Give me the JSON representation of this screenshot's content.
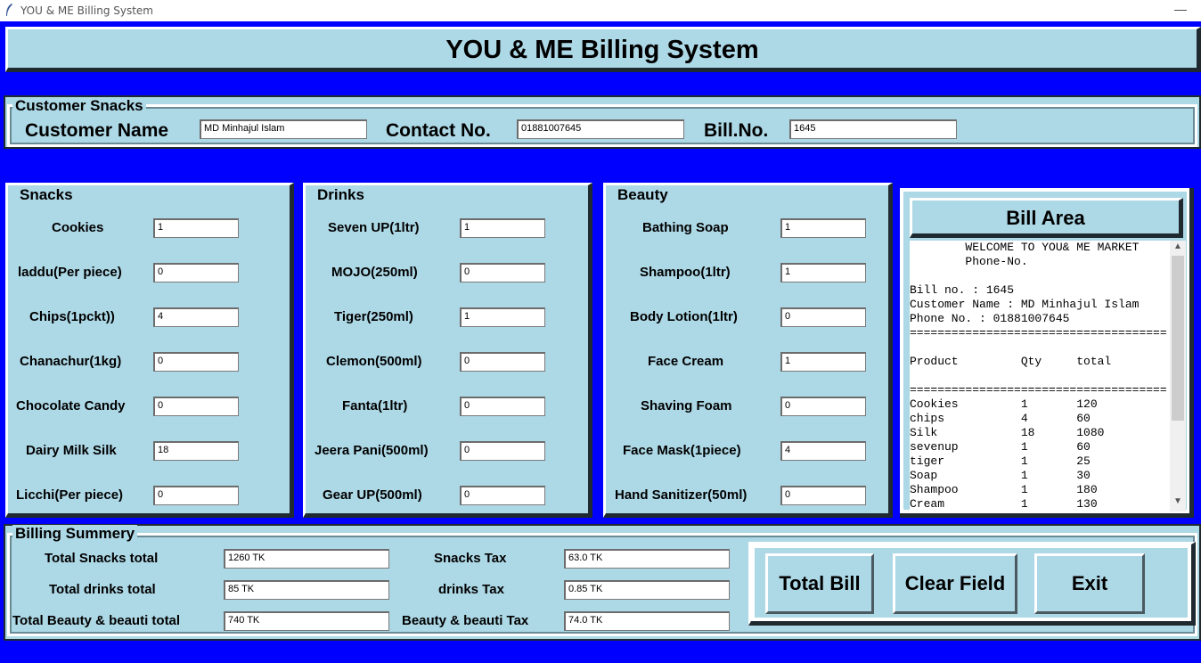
{
  "window": {
    "title": "YOU & ME Billing System",
    "minimize": "—"
  },
  "header": {
    "title": "YOU & ME Billing System"
  },
  "customer": {
    "frame_title": "Customer Snacks",
    "name_label": "Customer Name",
    "name_value": "MD Minhajul Islam",
    "contact_label": "Contact No.",
    "contact_value": "01881007645",
    "bill_label": "Bill.No.",
    "bill_value": "1645"
  },
  "snacks": {
    "frame_title": "Snacks",
    "items": [
      {
        "label": "Cookies",
        "value": "1"
      },
      {
        "label": "laddu(Per piece)",
        "value": "0"
      },
      {
        "label": "Chips(1pckt))",
        "value": "4"
      },
      {
        "label": "Chanachur(1kg)",
        "value": "0"
      },
      {
        "label": "Chocolate Candy",
        "value": "0"
      },
      {
        "label": "Dairy Milk Silk",
        "value": "18"
      },
      {
        "label": "Licchi(Per piece)",
        "value": "0"
      }
    ]
  },
  "drinks": {
    "frame_title": "Drinks",
    "items": [
      {
        "label": "Seven UP(1ltr)",
        "value": "1"
      },
      {
        "label": "MOJO(250ml)",
        "value": "0"
      },
      {
        "label": "Tiger(250ml)",
        "value": "1"
      },
      {
        "label": "Clemon(500ml)",
        "value": "0"
      },
      {
        "label": "Fanta(1ltr)",
        "value": "0"
      },
      {
        "label": "Jeera Pani(500ml)",
        "value": "0"
      },
      {
        "label": "Gear UP(500ml)",
        "value": "0"
      }
    ]
  },
  "beauty": {
    "frame_title": "Beauty",
    "items": [
      {
        "label": "Bathing Soap",
        "value": "1"
      },
      {
        "label": "Shampoo(1ltr)",
        "value": "1"
      },
      {
        "label": "Body Lotion(1ltr)",
        "value": "0"
      },
      {
        "label": "Face Cream",
        "value": "1"
      },
      {
        "label": "Shaving Foam",
        "value": "0"
      },
      {
        "label": "Face Mask(1piece)",
        "value": "4"
      },
      {
        "label": "Hand Sanitizer(50ml)",
        "value": "0"
      }
    ]
  },
  "bill_area": {
    "title": "Bill Area",
    "lines": [
      "        WELCOME TO YOU& ME MARKET",
      "        Phone-No.",
      "",
      "Bill no. : 1645",
      "Customer Name : MD Minhajul Islam",
      "Phone No. : 01881007645",
      "=====================================",
      "",
      "Product         Qty     total",
      "",
      "=====================================",
      "Cookies         1       120",
      "chips           4       60",
      "Silk            18      1080",
      "sevenup         1       60",
      "tiger           1       25",
      "Soap            1       30",
      "Shampoo         1       180",
      "Cream           1       130"
    ],
    "scroll_up": "▲",
    "scroll_down": "▼"
  },
  "summary": {
    "frame_title": "Billing Summery",
    "snacks_total_label": "Total Snacks total",
    "snacks_total_value": "1260 TK",
    "drinks_total_label": "Total drinks total",
    "drinks_total_value": "85 TK",
    "beauty_total_label": "Total Beauty & beauti total",
    "beauty_total_value": "740 TK",
    "snacks_tax_label": "Snacks Tax",
    "snacks_tax_value": "63.0 TK",
    "drinks_tax_label": "drinks Tax",
    "drinks_tax_value": "0.85 TK",
    "beauty_tax_label": "Beauty & beauti Tax",
    "beauty_tax_value": "74.0 TK"
  },
  "buttons": {
    "total": "Total Bill",
    "clear": "Clear Field",
    "exit": "Exit"
  },
  "colors": {
    "panel": "#add8e6",
    "background": "#0000ff"
  }
}
